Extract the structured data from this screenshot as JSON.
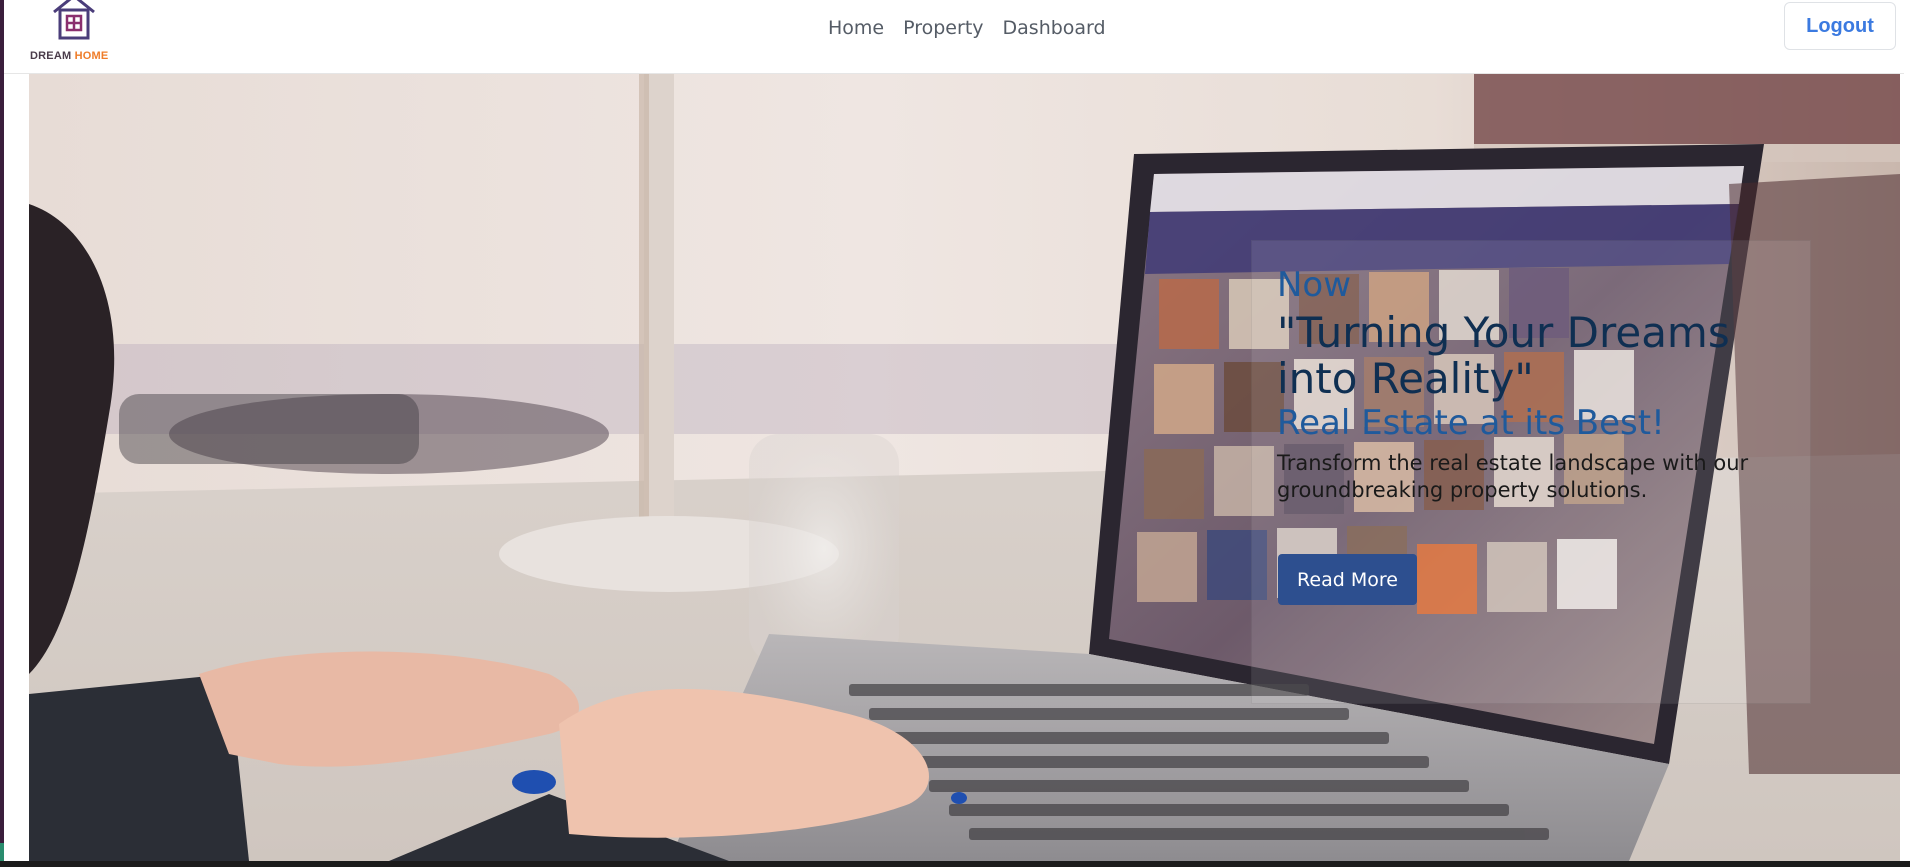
{
  "brand": {
    "name_part1": "DREAM",
    "name_part2": "HOME",
    "logo_icon": "house-icon",
    "colors": {
      "house_stroke": "#3f3566",
      "dream_text": "#4a3c4a",
      "home_text": "#ef7d2a"
    }
  },
  "nav": {
    "items": [
      {
        "label": "Home"
      },
      {
        "label": "Property"
      },
      {
        "label": "Dashboard"
      }
    ],
    "logout_label": "Logout"
  },
  "hero": {
    "eyebrow": "Now",
    "headline": "\"Turning Your Dreams into Reality\"",
    "tagline": "Real Estate at its Best!",
    "description": "Transform the real estate landscape with our groundbreaking property solutions.",
    "cta_label": "Read More",
    "background_image": "laptop-on-desk-photo",
    "colors": {
      "eyebrow": "#1f5a9c",
      "headline": "#0f2f52",
      "cta_bg": "#2d4f8f"
    }
  }
}
